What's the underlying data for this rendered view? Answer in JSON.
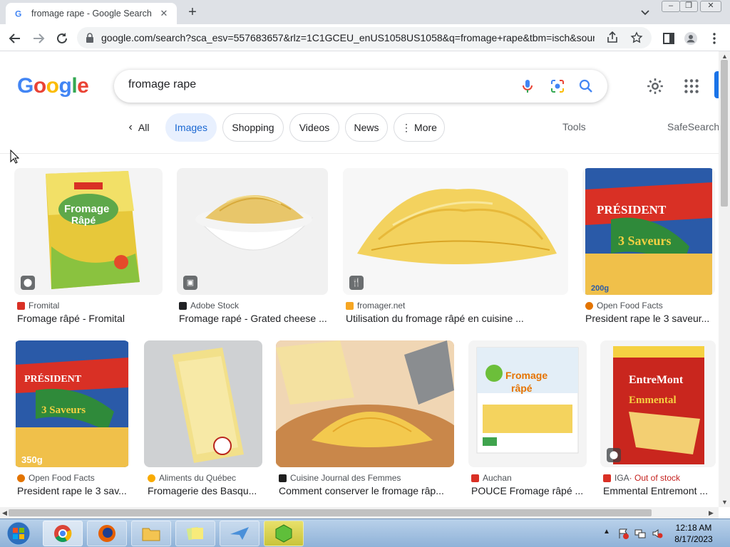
{
  "browser": {
    "tab_title": "fromage rape - Google Search",
    "new_tab_label": "+",
    "url": "google.com/search?sca_esv=557683657&rlz=1C1GCEU_enUS1058US1058&q=fromage+rape&tbm=isch&sourc..."
  },
  "google": {
    "logo": "Google",
    "query": "fromage rape"
  },
  "filters": {
    "back_label": "All",
    "chips": [
      "Images",
      "Shopping",
      "Videos",
      "News",
      "More"
    ],
    "tools": "Tools",
    "safesearch": "SafeSearch"
  },
  "results": [
    {
      "source": "Fromital",
      "title": "Fromage râpé - Fromital",
      "badge": "tag-icon",
      "source_color": "#d93025"
    },
    {
      "source": "Adobe Stock",
      "title": "Fromage rapé - Grated cheese ...",
      "badge": "image-icon",
      "source_color": "#202124"
    },
    {
      "source": "fromager.net",
      "title": "Utilisation du fromage râpé en cuisine ...",
      "badge": "recipe-icon",
      "source_color": "#f6a623"
    },
    {
      "source": "Open Food Facts",
      "title": "President rape le 3 saveur...",
      "badge": "",
      "source_color": "#e37400"
    },
    {
      "source": "Open Food Facts",
      "title": "President rape le 3 sav...",
      "badge": "",
      "source_color": "#e37400"
    },
    {
      "source": "Aliments du Québec",
      "title": "Fromagerie des Basqu...",
      "badge": "",
      "source_color": "#f9ab00"
    },
    {
      "source": "Cuisine Journal des Femmes",
      "title": "Comment conserver le fromage râp...",
      "badge": "",
      "source_color": "#1f1f1f"
    },
    {
      "source": "Auchan",
      "title": "POUCE Fromage râpé ...",
      "badge": "",
      "source_color": "#d93025"
    },
    {
      "source": "IGA",
      "source_extra": " · Out of stock",
      "title": "Emmental Entremont ...",
      "badge": "tag-icon",
      "source_color": "#d93025"
    }
  ],
  "taskbar": {
    "time": "12:18 AM",
    "date": "8/17/2023"
  },
  "colors": {
    "google_blue": "#4285f4",
    "google_red": "#ea4335",
    "google_yellow": "#fbbc05",
    "google_green": "#34a853",
    "out_of_stock": "#c5221f"
  }
}
